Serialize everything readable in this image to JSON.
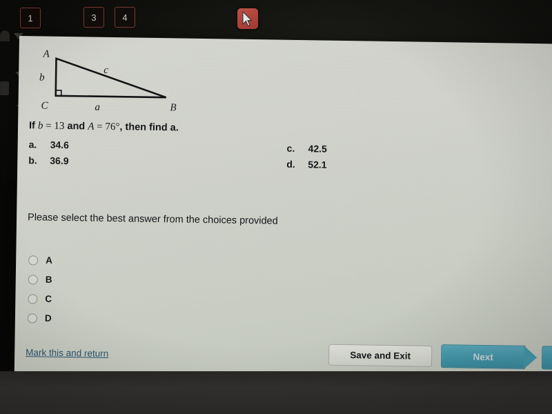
{
  "toolbar": {
    "chips": [
      "1",
      "3",
      "4"
    ],
    "pointer_button": {
      "icon": "cursor-arrow-icon",
      "color": "#ad4239"
    }
  },
  "figure": {
    "name": "right-triangle-diagram",
    "vertices": {
      "A": "A",
      "B": "B",
      "C": "C"
    },
    "sides": {
      "a": "a",
      "b": "b",
      "c": "c"
    },
    "right_angle_at": "C"
  },
  "question": {
    "prefix": "If ",
    "var_b": "b",
    "eq1": " = ",
    "val_b": "13",
    "conj": " and ",
    "var_A": "A",
    "eq2": " = ",
    "val_A": "76°",
    "suffix": ", then find a."
  },
  "choices": [
    {
      "key": "a.",
      "value": "34.6"
    },
    {
      "key": "b.",
      "value": "36.9"
    },
    {
      "key": "c.",
      "value": "42.5"
    },
    {
      "key": "d.",
      "value": "52.1"
    }
  ],
  "prompt": "Please select the best answer from the choices provided",
  "radios": [
    {
      "label": "A",
      "selected": false
    },
    {
      "label": "B",
      "selected": false
    },
    {
      "label": "C",
      "selected": false
    },
    {
      "label": "D",
      "selected": false
    }
  ],
  "footer": {
    "mark_link": "Mark this and return",
    "save_button": "Save and Exit",
    "next_button": "Next",
    "next_color": "#459aae",
    "link_color": "#2c5670"
  }
}
